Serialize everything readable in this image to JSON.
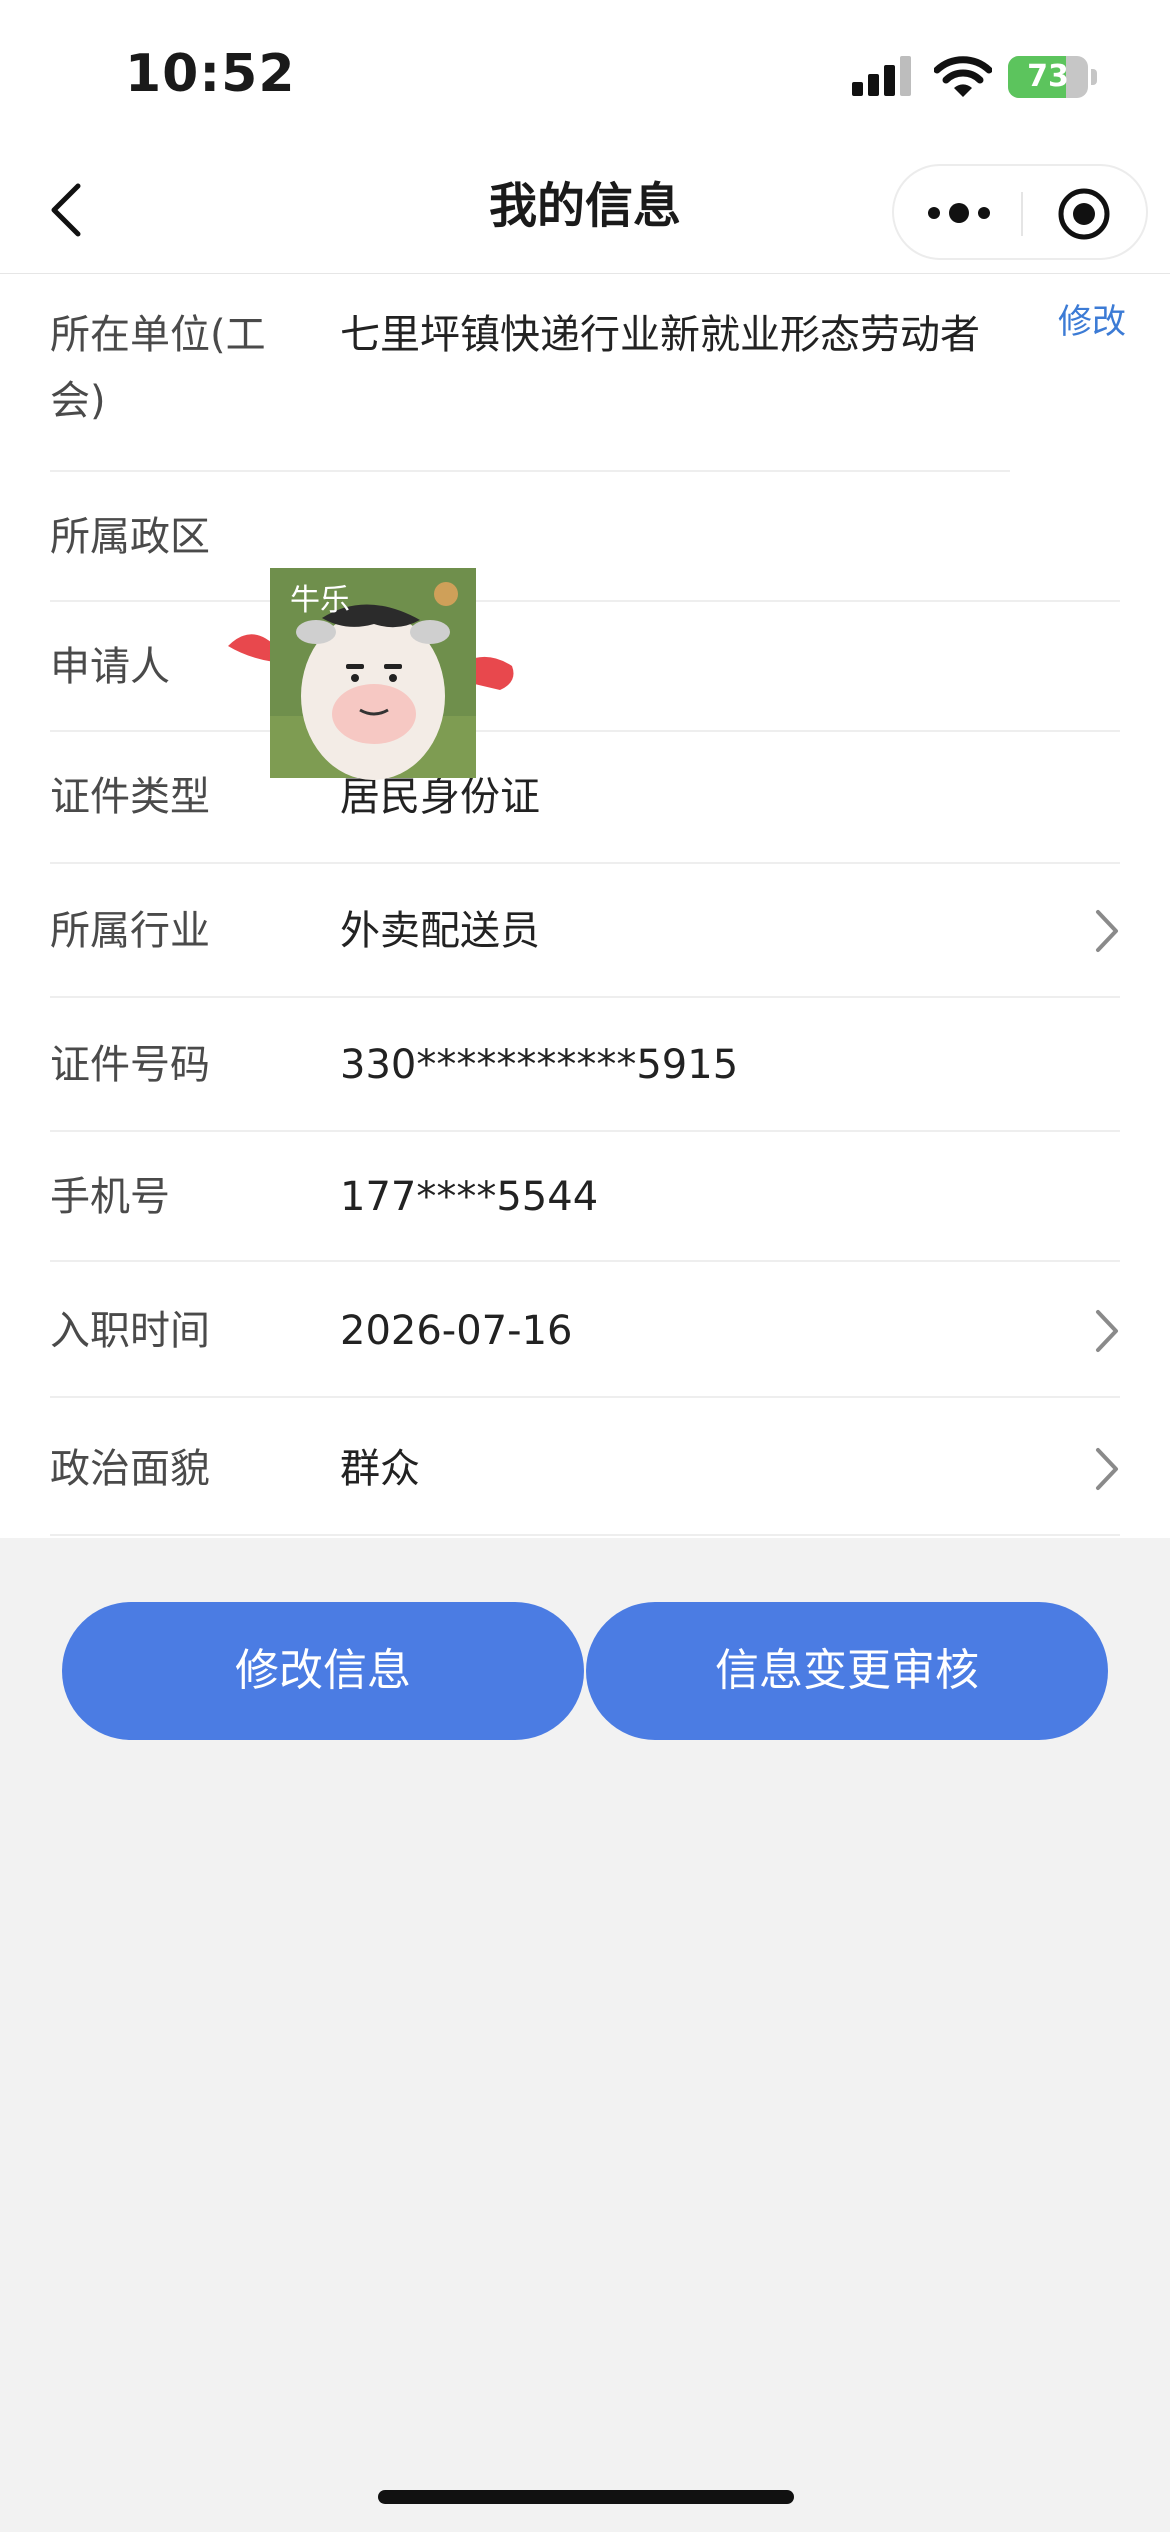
{
  "status_bar": {
    "time": "10:52",
    "battery": "73",
    "battery_level": 0.73
  },
  "nav": {
    "title": "我的信息"
  },
  "info": {
    "edit_link": "修改",
    "rows": [
      {
        "label": "所在单位(工会)",
        "value": "七里坪镇快递行业新就业形态劳动者"
      },
      {
        "label": "所属政区",
        "value": ""
      },
      {
        "label": "申请人",
        "value": ""
      },
      {
        "label": "证件类型",
        "value": "居民身份证"
      },
      {
        "label": "所属行业",
        "value": "外卖配送员"
      },
      {
        "label": "证件号码",
        "value": "330***********5915"
      },
      {
        "label": "手机号",
        "value": "177****5544"
      },
      {
        "label": "入职时间",
        "value": "2026-07-16"
      },
      {
        "label": "政治面貌",
        "value": "群众"
      }
    ]
  },
  "sticker": {
    "text": "牛乐"
  },
  "actions": {
    "edit_info": "修改信息",
    "change_review": "信息变更审核"
  },
  "colors": {
    "primary": "#4b7ce3",
    "link": "#3c7bd5",
    "battery": "#5cc45d"
  }
}
